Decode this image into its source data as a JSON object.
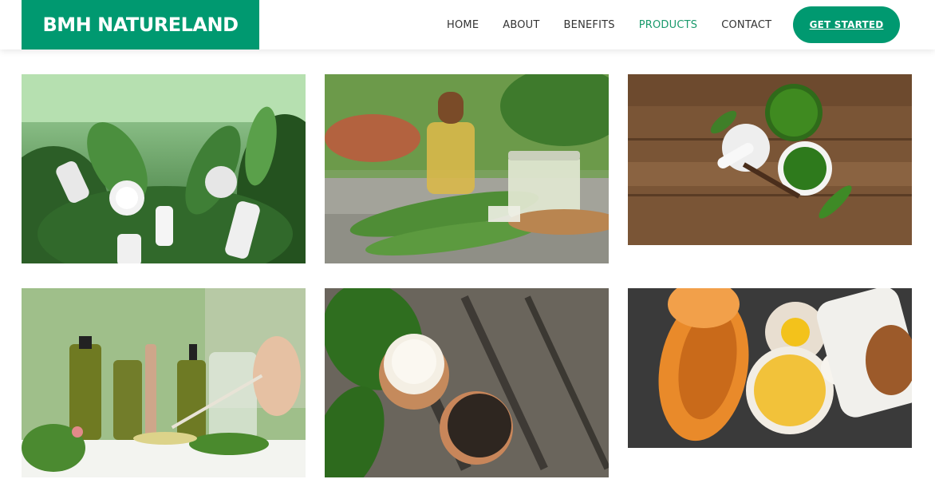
{
  "header": {
    "logo_text": "BMH NATURELAND",
    "nav": [
      {
        "label": "HOME"
      },
      {
        "label": "ABOUT"
      },
      {
        "label": "BENEFITS"
      },
      {
        "label": "PRODUCTS"
      },
      {
        "label": "CONTACT"
      }
    ],
    "active_nav": "PRODUCTS",
    "cta_label": "GET STARTED"
  },
  "colors": {
    "brand_green": "#009970",
    "active_link": "#1a9a6c",
    "nav_text": "#333333",
    "background": "#ffffff"
  },
  "gallery": {
    "items": [
      {
        "alt": "White cosmetic bottles among green leaves"
      },
      {
        "alt": "Aloe vera oil bottle and gel jar with spoon"
      },
      {
        "alt": "Herbal paste bowls with mortar and pestle on wood"
      },
      {
        "alt": "Laboratory glassware with herbal oils"
      },
      {
        "alt": "Cream jars with green leaves on wooden planks"
      },
      {
        "alt": "Papaya halves with face mask powder and towel"
      }
    ]
  }
}
